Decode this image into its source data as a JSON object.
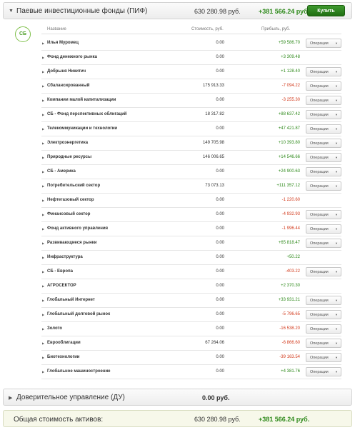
{
  "pif": {
    "title": "Паевые инвестиционные фонды (ПИФ)",
    "amount": "630 280.98 руб.",
    "profit": "+381 566.24 руб.",
    "buy_label": "Купить",
    "logo_text": "СБ"
  },
  "table": {
    "col_name": "Название",
    "col_cost": "Стоимость, руб.",
    "col_profit": "Прибыль, руб.",
    "ops_label": "Операции",
    "rows": [
      {
        "name": "Илья Муромец",
        "cost": "0.00",
        "profit": "+59 586.70",
        "sign": "pos",
        "ops": true
      },
      {
        "name": "Фонд денежного рынка",
        "cost": "0.00",
        "profit": "+3 309.48",
        "sign": "pos",
        "ops": false
      },
      {
        "name": "Добрыня Никитич",
        "cost": "0.00",
        "profit": "+1 128.40",
        "sign": "pos",
        "ops": true
      },
      {
        "name": "Сбалансированный",
        "cost": "175 913.33",
        "profit": "-7 094.22",
        "sign": "neg",
        "ops": true
      },
      {
        "name": "Компании малой капитализации",
        "cost": "0.00",
        "profit": "-3 255.30",
        "sign": "neg",
        "ops": true
      },
      {
        "name": "СБ - Фонд перспективных облигаций",
        "cost": "18 317.82",
        "profit": "+88 637.42",
        "sign": "pos",
        "ops": true
      },
      {
        "name": "Телекоммуникации и технологии",
        "cost": "0.00",
        "profit": "+47 421.87",
        "sign": "pos",
        "ops": true
      },
      {
        "name": "Электроэнергетика",
        "cost": "149 705.98",
        "profit": "+10 393.80",
        "sign": "pos",
        "ops": true
      },
      {
        "name": "Природные ресурсы",
        "cost": "146 006.65",
        "profit": "+14 546.66",
        "sign": "pos",
        "ops": true
      },
      {
        "name": "СБ - Америка",
        "cost": "0.00",
        "profit": "+24 900.63",
        "sign": "pos",
        "ops": true
      },
      {
        "name": "Потребительский сектор",
        "cost": "73 073.13",
        "profit": "+111 357.12",
        "sign": "pos",
        "ops": true
      },
      {
        "name": "Нефтегазовый сектор",
        "cost": "0.00",
        "profit": "-1 220.60",
        "sign": "neg",
        "ops": false
      },
      {
        "name": "Финансовый сектор",
        "cost": "0.00",
        "profit": "-4 932.93",
        "sign": "neg",
        "ops": true
      },
      {
        "name": "Фонд активного управления",
        "cost": "0.00",
        "profit": "-1 996.44",
        "sign": "neg",
        "ops": true
      },
      {
        "name": "Развивающиеся рынки",
        "cost": "0.00",
        "profit": "+65 818.47",
        "sign": "pos",
        "ops": true
      },
      {
        "name": "Инфраструктура",
        "cost": "0.00",
        "profit": "+50.22",
        "sign": "pos",
        "ops": false
      },
      {
        "name": "СБ - Европа",
        "cost": "0.00",
        "profit": "-403.22",
        "sign": "neg",
        "ops": true
      },
      {
        "name": "АГРОСЕКТОР",
        "cost": "0.00",
        "profit": "+2 370.30",
        "sign": "pos",
        "ops": false
      },
      {
        "name": "Глобальный Интернет",
        "cost": "0.00",
        "profit": "+33 931.21",
        "sign": "pos",
        "ops": true
      },
      {
        "name": "Глобальный долговой рынок",
        "cost": "0.00",
        "profit": "-5 796.65",
        "sign": "neg",
        "ops": true
      },
      {
        "name": "Золото",
        "cost": "0.00",
        "profit": "-16 538.20",
        "sign": "neg",
        "ops": true
      },
      {
        "name": "Еврооблигации",
        "cost": "67 264.06",
        "profit": "-6 866.60",
        "sign": "neg",
        "ops": true
      },
      {
        "name": "Биотехнологии",
        "cost": "0.00",
        "profit": "-39 163.54",
        "sign": "neg",
        "ops": true
      },
      {
        "name": "Глобальное машиностроение",
        "cost": "0.00",
        "profit": "+4 381.76",
        "sign": "pos",
        "ops": true
      }
    ]
  },
  "du": {
    "title": "Доверительное управление (ДУ)",
    "amount": "0.00 руб."
  },
  "total": {
    "label": "Общая стоимость активов:",
    "amount": "630 280.98 руб.",
    "profit": "+381 566.24 руб."
  },
  "colors": {
    "positive": "#2f8a1c",
    "negative": "#d23a1c",
    "buy_button": "#2f8a1c"
  }
}
